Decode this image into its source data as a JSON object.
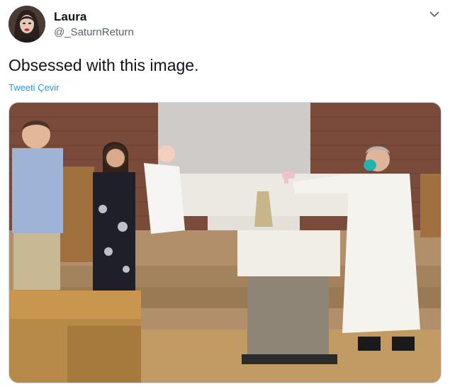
{
  "tweet": {
    "author_name": "Laura",
    "author_handle": "@_SaturnReturn",
    "text": "Obsessed with this image.",
    "translate_label": "Tweeti Çevir"
  },
  "icons": {
    "menu": "chevron-down-icon"
  },
  "colors": {
    "link": "#1d9bf0",
    "secondary_text": "#536471"
  }
}
